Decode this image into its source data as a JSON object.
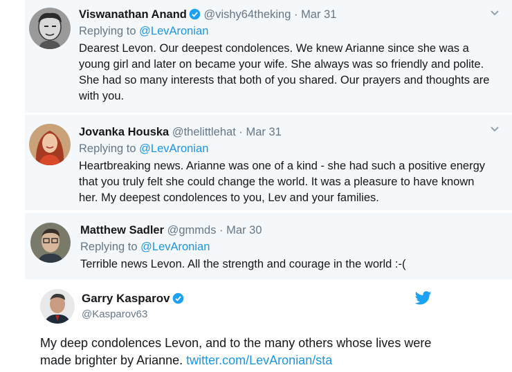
{
  "replies": [
    {
      "name": "Viswanathan Anand",
      "verified": true,
      "handle": "@vishy64theking",
      "date": "Mar 31",
      "replying_prefix": "Replying to ",
      "replying_to": "@LevAronian",
      "text": "Dearest Levon. Our deepest condolences. We knew Arianne since she was a young girl and later on became your wife. She always was so friendly  and polite. She had so many interests that both of you shared. Our prayers and thoughts are with you."
    },
    {
      "name": "Jovanka Houska",
      "verified": false,
      "handle": "@thelittlehat",
      "date": "Mar 31",
      "replying_prefix": "Replying to ",
      "replying_to": "@LevAronian",
      "text": "Heartbreaking news. Arianne was one of a kind - she had such a positive energy that you truly felt she could change the world. It was a pleasure to have known her. My deepest condolences to you, Lev and your families."
    },
    {
      "name": "Matthew Sadler",
      "verified": false,
      "handle": "@gmmds",
      "date": "Mar 30",
      "replying_prefix": "Replying to ",
      "replying_to": "@LevAronian",
      "text": "Terrible news Levon. All the strength and courage in the world :-("
    }
  ],
  "separator": "·",
  "main_tweet": {
    "name": "Garry Kasparov",
    "verified": true,
    "handle": "@Kasparov63",
    "text": "My deep condolences Levon, and to the many others whose lives were made brighter by Arianne. ",
    "link": "twitter.com/LevAronian/sta"
  },
  "colors": {
    "accent": "#1b95e0",
    "verified": "#1da1f2",
    "muted": "#657786",
    "reply_bg": "#f5f8fa"
  },
  "icons": [
    "verified-badge-icon",
    "chevron-down-icon",
    "twitter-bird-icon"
  ]
}
